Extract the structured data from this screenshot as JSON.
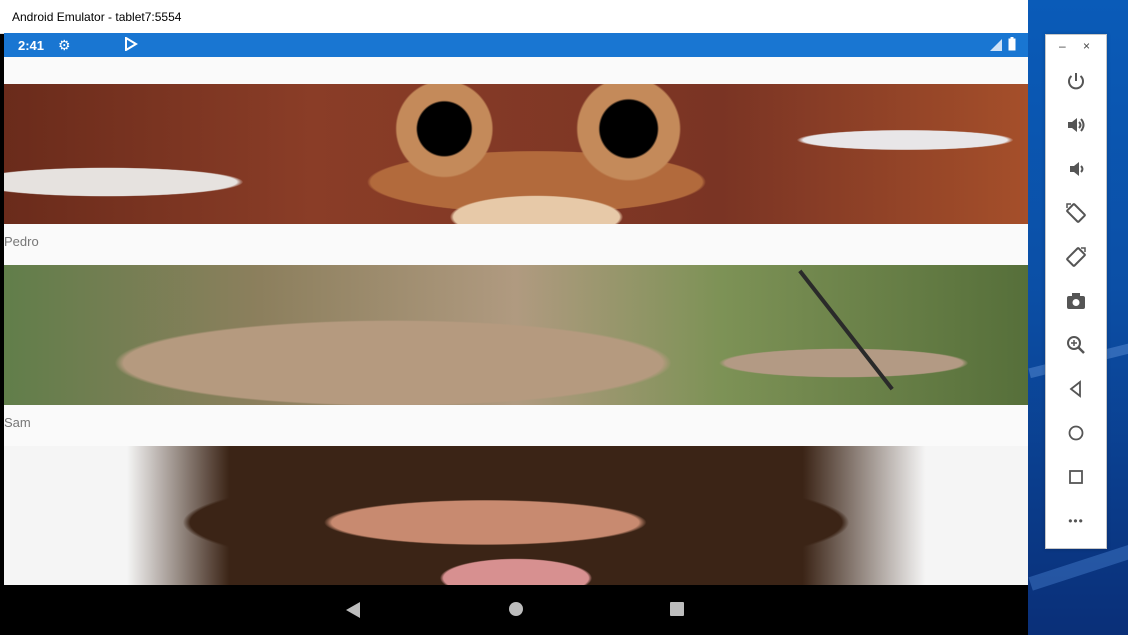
{
  "window": {
    "title": "Android Emulator - tablet7:5554"
  },
  "statusbar": {
    "time": "2:41",
    "color": "#1976d2"
  },
  "list": {
    "items": [
      {
        "name": "Pedro"
      },
      {
        "name": "Sam"
      }
    ]
  },
  "navbar": {
    "back_icon": "back-icon",
    "home_icon": "home-icon",
    "recents_icon": "recents-icon"
  },
  "toolbar": {
    "minimize_label": "–",
    "close_label": "×",
    "buttons": [
      "power-icon",
      "volume-up-icon",
      "volume-down-icon",
      "rotate-left-icon",
      "rotate-right-icon",
      "camera-icon",
      "zoom-icon",
      "back-icon",
      "home-icon",
      "overview-icon",
      "more-icon"
    ],
    "more_label": "•••"
  }
}
